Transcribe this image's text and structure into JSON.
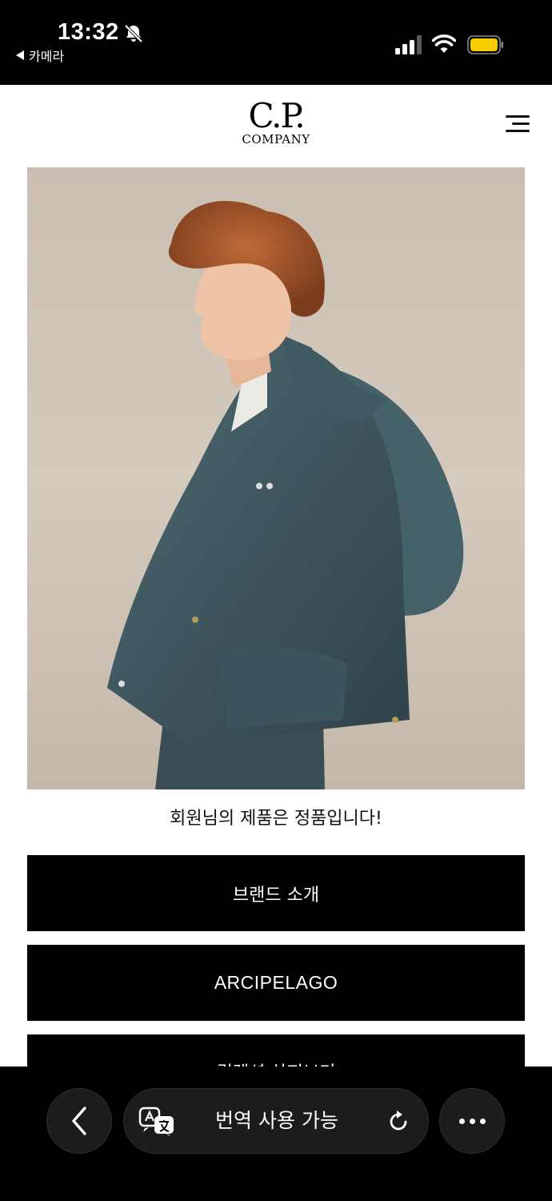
{
  "status_bar": {
    "time": "13:32",
    "back_app": "카메라",
    "battery_color": "#f5cc00"
  },
  "header": {
    "logo_top": "C.P.",
    "logo_bottom": "COMPANY"
  },
  "hero": {
    "icon": "model-photo"
  },
  "auth_message": "회원님의 제품은 정품입니다!",
  "menu": [
    {
      "label": "브랜드 소개"
    },
    {
      "label": "ARCIPELAGO"
    },
    {
      "label": "컬렉션 살펴보기"
    }
  ],
  "browser": {
    "translate_label": "번역 사용 가능"
  }
}
